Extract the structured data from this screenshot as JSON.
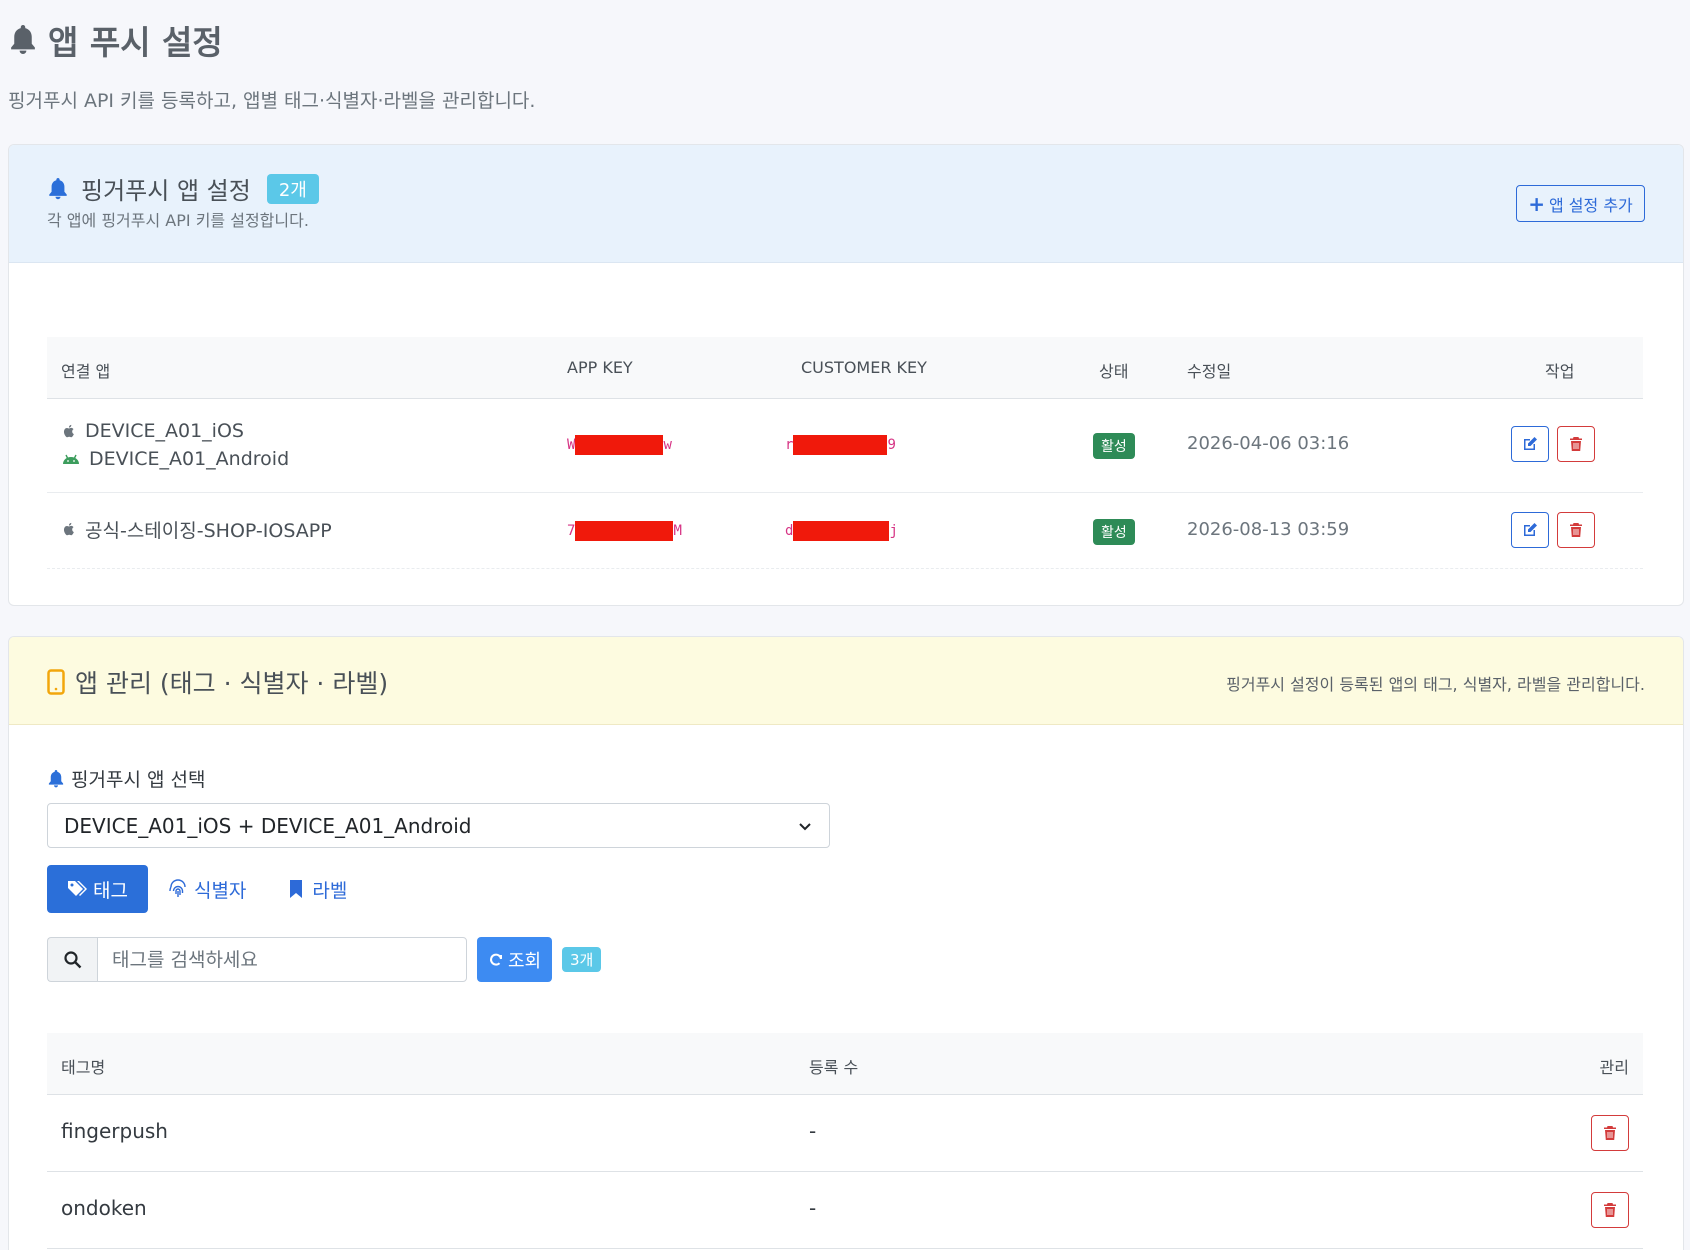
{
  "header": {
    "title": "앱 푸시 설정",
    "description": "핑거푸시 API 키를 등록하고, 앱별 태그·식별자·라벨을 관리합니다."
  },
  "push_settings": {
    "title": "핑거푸시 앱 설정",
    "count_badge": "2개",
    "subtitle": "각 앱에 핑거푸시 API 키를 설정합니다.",
    "add_button": "앱 설정 추가",
    "columns": {
      "app": "연결 앱",
      "app_key": "APP KEY",
      "customer_key": "CUSTOMER KEY",
      "status": "상태",
      "modified": "수정일",
      "actions": "작업"
    },
    "rows": [
      {
        "apps": [
          {
            "platform": "apple-icon",
            "name": "DEVICE_A01_iOS"
          },
          {
            "platform": "android-icon",
            "name": "DEVICE_A01_Android"
          }
        ],
        "app_key_start": "W",
        "app_key_end": "w",
        "customer_key_start": "r",
        "customer_key_end": "9",
        "status": "활성",
        "modified": "2026-04-06 03:16"
      },
      {
        "apps": [
          {
            "platform": "apple-icon",
            "name": "공식-스테이징-SHOP-IOSAPP"
          }
        ],
        "app_key_start": "7",
        "app_key_end": "M",
        "customer_key_start": "d",
        "customer_key_end": "j",
        "status": "활성",
        "modified": "2026-08-13 03:59"
      }
    ]
  },
  "app_management": {
    "title": "앱 관리 (태그 · 식별자 · 라벨)",
    "description": "핑거푸시 설정이 등록된 앱의 태그, 식별자, 라벨을 관리합니다.",
    "select_label": "핑거푸시 앱 선택",
    "selected_app": "DEVICE_A01_iOS + DEVICE_A01_Android",
    "tabs": [
      {
        "label": "태그",
        "icon": "tags-icon",
        "active": true
      },
      {
        "label": "식별자",
        "icon": "fingerprint-icon",
        "active": false
      },
      {
        "label": "라벨",
        "icon": "bookmark-icon",
        "active": false
      }
    ],
    "search_placeholder": "태그를 검색하세요",
    "search_button": "조회",
    "result_count": "3개",
    "columns": {
      "tag_name": "태그명",
      "reg_count": "등록 수",
      "manage": "관리"
    },
    "tags": [
      {
        "name": "fingerpush",
        "count": "-"
      },
      {
        "name": "ondoken",
        "count": "-"
      }
    ]
  },
  "colors": {
    "primary": "#2b6fd9",
    "danger": "#d33b3b",
    "success": "#2e8b57",
    "info": "#5bc8e8",
    "redaction": "#f0190b"
  }
}
